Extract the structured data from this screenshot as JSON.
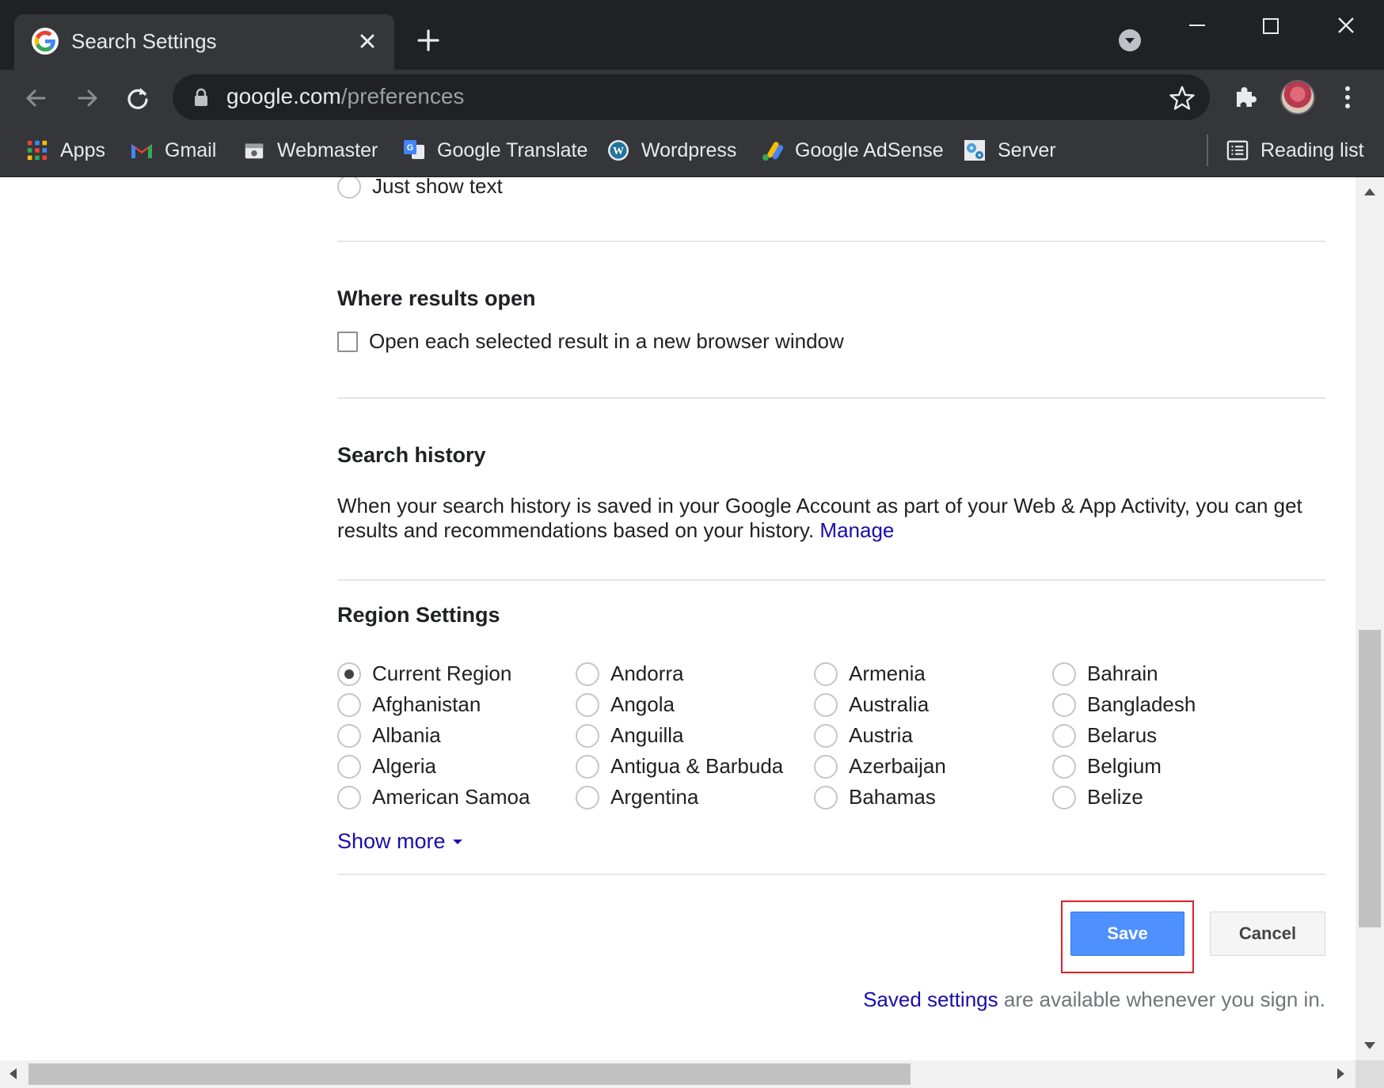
{
  "browser": {
    "tab": {
      "title": "Search Settings",
      "favicon": "google-g-icon"
    },
    "url": {
      "host": "google.com",
      "path": "/preferences"
    },
    "bookmarks": [
      {
        "label": "Apps",
        "icon": "apps-grid-icon"
      },
      {
        "label": "Gmail",
        "icon": "gmail-icon"
      },
      {
        "label": "Webmaster",
        "icon": "webmaster-icon"
      },
      {
        "label": "Google Translate",
        "icon": "translate-icon"
      },
      {
        "label": "Wordpress",
        "icon": "wordpress-icon"
      },
      {
        "label": "Google AdSense",
        "icon": "adsense-icon"
      },
      {
        "label": "Server",
        "icon": "server-icon"
      }
    ],
    "reading_list": {
      "label": "Reading list",
      "icon": "reading-list-icon"
    }
  },
  "page": {
    "prev_option": {
      "label": "Just show text"
    },
    "where_results_open": {
      "heading": "Where results open",
      "checkbox_label": "Open each selected result in a new browser window",
      "checked": false
    },
    "search_history": {
      "heading": "Search history",
      "text": "When your search history is saved in your Google Account as part of your Web & App Activity, you can get results and recommendations based on your history.",
      "link": "Manage"
    },
    "region_settings": {
      "heading": "Region Settings",
      "selected": "Current Region",
      "columns": [
        [
          "Current Region",
          "Afghanistan",
          "Albania",
          "Algeria",
          "American Samoa"
        ],
        [
          "Andorra",
          "Angola",
          "Anguilla",
          "Antigua & Barbuda",
          "Argentina"
        ],
        [
          "Armenia",
          "Australia",
          "Austria",
          "Azerbaijan",
          "Bahamas"
        ],
        [
          "Bahrain",
          "Bangladesh",
          "Belarus",
          "Belgium",
          "Belize"
        ]
      ],
      "show_more": "Show more"
    },
    "actions": {
      "save": "Save",
      "cancel": "Cancel"
    },
    "footer": {
      "link": "Saved settings",
      "text": " are available whenever you sign in."
    }
  },
  "colors": {
    "chrome_dark": "#202124",
    "chrome_toolbar": "#35363a",
    "link": "#1a0dab",
    "save_button": "#4d90fe",
    "highlight": "#e0202a"
  }
}
